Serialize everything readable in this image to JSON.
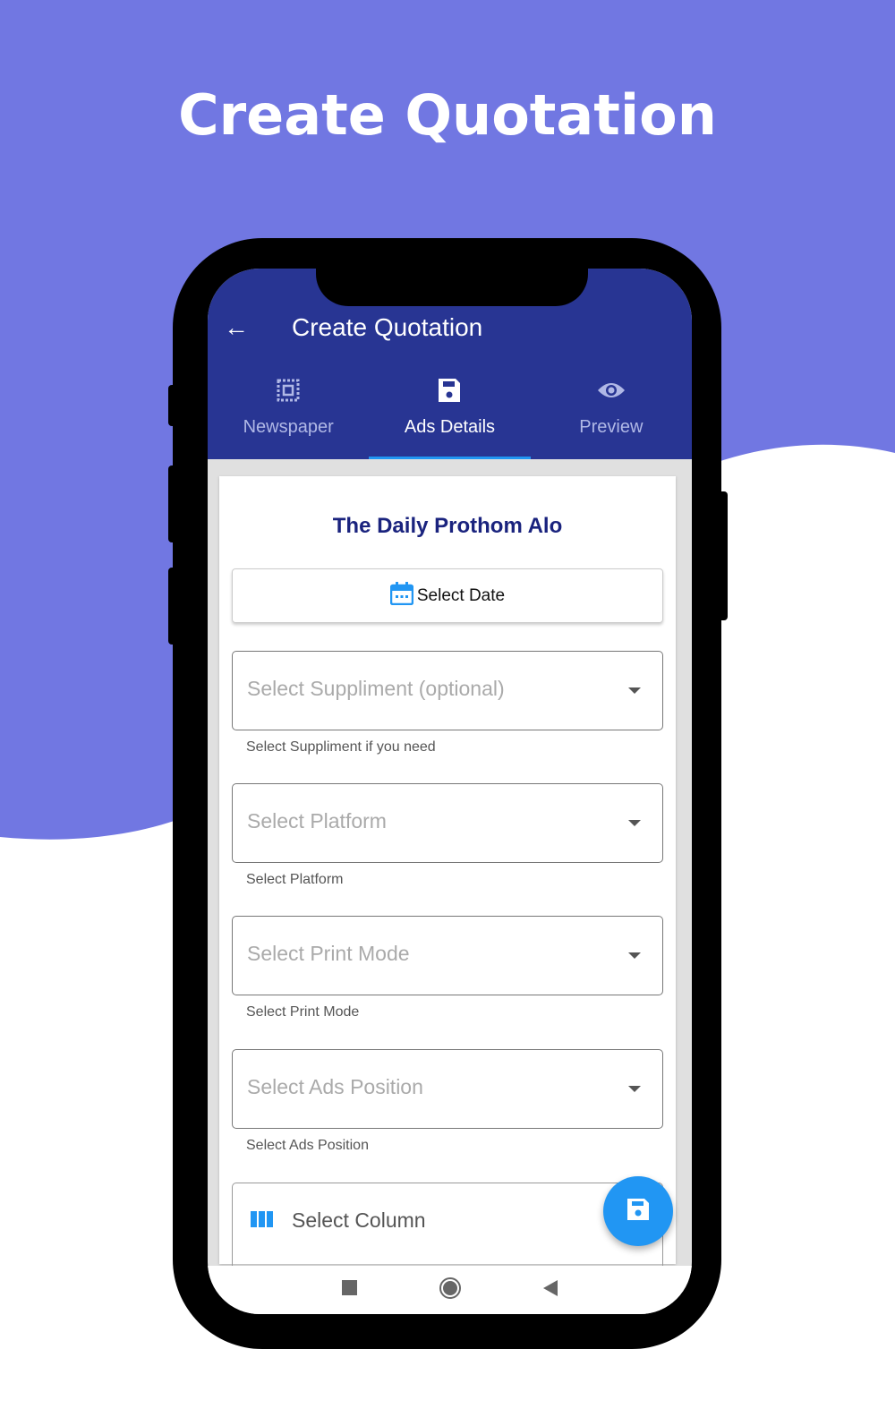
{
  "colors": {
    "background_purple": "#7177e2",
    "appbar": "#283593",
    "accent": "#2196f3"
  },
  "headline": "Create Quotation",
  "appbar": {
    "title": "Create Quotation",
    "back_icon": "arrow-left-icon"
  },
  "tabs": [
    {
      "label": "Newspaper",
      "icon": "select-all-icon"
    },
    {
      "label": "Ads Details",
      "icon": "save-icon",
      "active": true
    },
    {
      "label": "Preview",
      "icon": "eye-icon"
    }
  ],
  "form": {
    "newspaper_name": "The Daily Prothom Alo",
    "date_button": "Select Date",
    "fields": [
      {
        "placeholder": "Select Suppliment (optional)",
        "helper": "Select Suppliment if you need"
      },
      {
        "placeholder": "Select Platform",
        "helper": "Select Platform"
      },
      {
        "placeholder": "Select Print Mode",
        "helper": "Select Print Mode"
      },
      {
        "placeholder": "Select Ads Position",
        "helper": "Select Ads Position"
      }
    ],
    "column_field": "Select Column"
  }
}
